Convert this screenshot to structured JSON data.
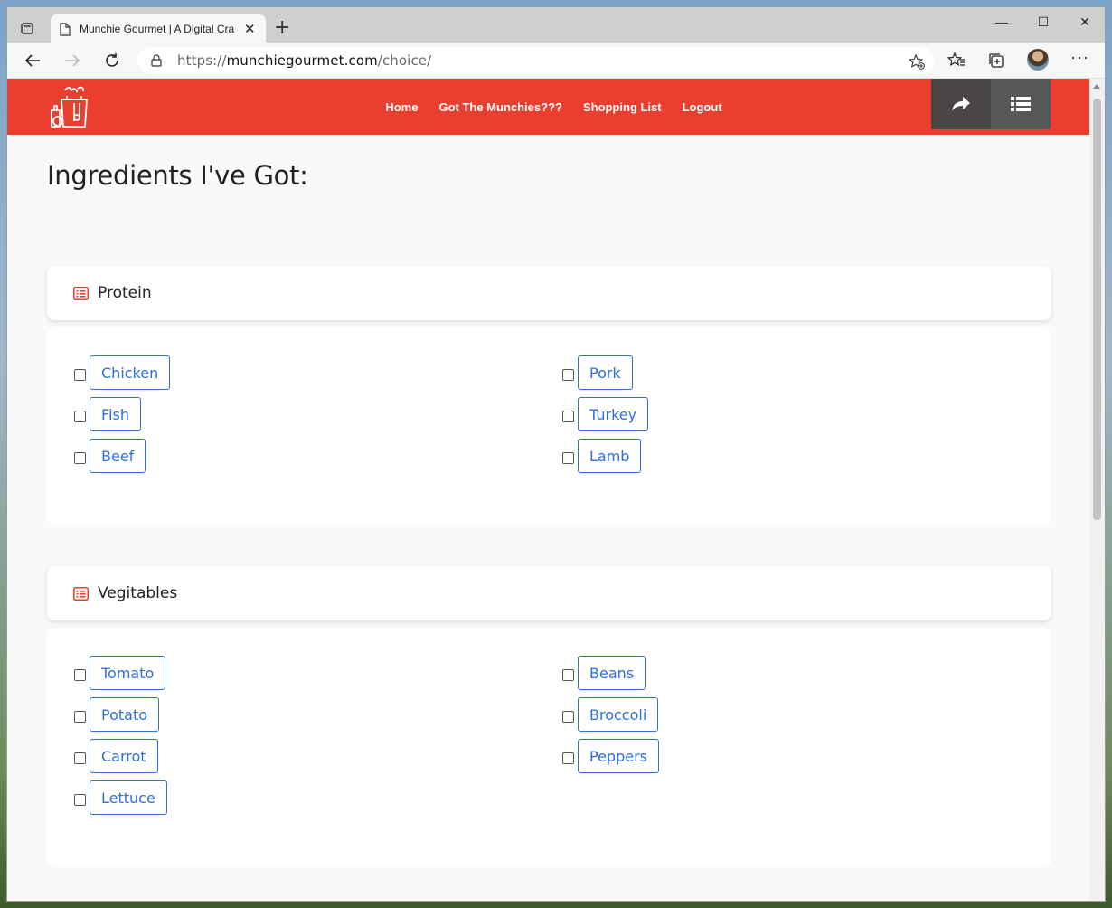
{
  "browser": {
    "tab_title": "Munchie Gourmet | A Digital Cra",
    "tab_close": "✕",
    "new_tab": "+",
    "url_prefix": "https://",
    "url_host": "munchiegourmet.com",
    "url_path": "/choice/",
    "minimize": "—",
    "maximize": "☐",
    "close": "✕",
    "more": "···"
  },
  "site": {
    "brand_color": "#ea3f2e",
    "nav": [
      "Home",
      "Got The Munchies???",
      "Shopping List",
      "Logout"
    ],
    "header_buttons": [
      "share-icon",
      "list-icon"
    ]
  },
  "page": {
    "title": "Ingredients I've Got:"
  },
  "sections": [
    {
      "title": "Protein",
      "left": [
        "Chicken",
        "Fish",
        "Beef"
      ],
      "right": [
        "Pork",
        "Turkey",
        "Lamb"
      ]
    },
    {
      "title": "Vegitables",
      "left": [
        "Tomato",
        "Potato",
        "Carrot",
        "Lettuce"
      ],
      "right": [
        "Beans",
        "Broccoli",
        "Peppers"
      ]
    }
  ],
  "colors": {
    "accent": "#ea3f2e",
    "chip": "#2f6fd6",
    "header_btn_dark": "#4a4646"
  }
}
